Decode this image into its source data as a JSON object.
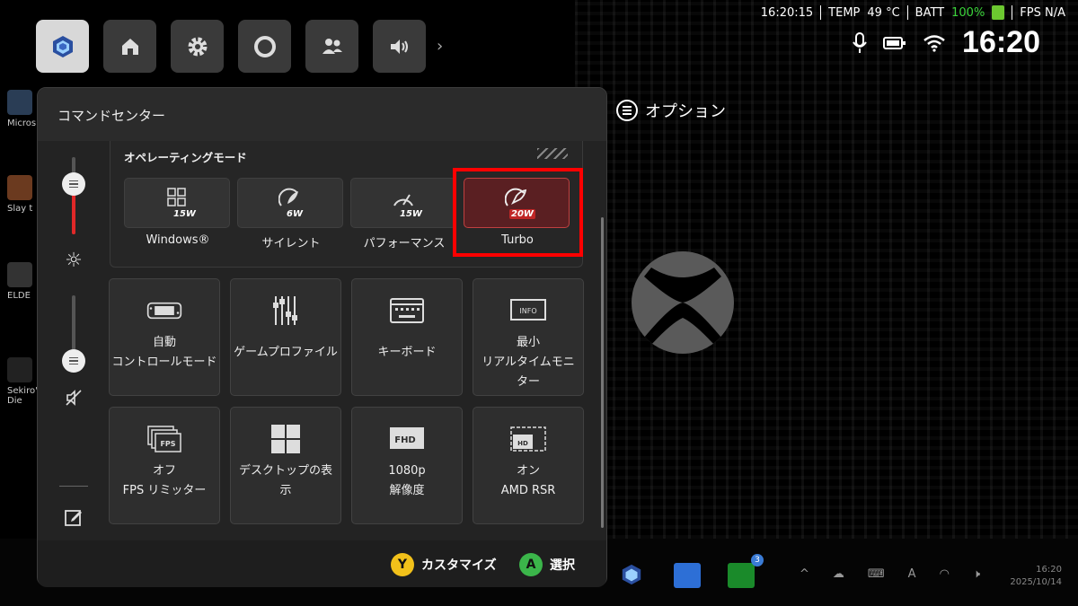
{
  "status": {
    "time_small": "16:20:15",
    "temp_label": "TEMP",
    "temp_value": "49 °C",
    "batt_label": "BATT",
    "batt_value": "100%",
    "fps_label": "FPS N/A",
    "clock": "16:20"
  },
  "options_label": "オプション",
  "desktop_icons": [
    "Micros",
    "Slay t",
    "ELDE",
    "Sekiro\" Die"
  ],
  "panel": {
    "title": "コマンドセンター",
    "operating_mode": {
      "title": "オペレーティングモード",
      "modes": [
        {
          "label": "Windows®",
          "watt": "15W",
          "icon": "windows-grid-icon"
        },
        {
          "label": "サイレント",
          "watt": "6W",
          "icon": "leaf-gauge-icon"
        },
        {
          "label": "パフォーマンス",
          "watt": "15W",
          "icon": "gauge-icon"
        },
        {
          "label": "Turbo",
          "watt": "20W",
          "icon": "rocket-gauge-icon",
          "selected": true
        }
      ]
    },
    "tiles": [
      {
        "line1": "自動",
        "line2": "コントロールモード",
        "icon": "handheld-controller-icon"
      },
      {
        "line1": "ゲームプロファイル",
        "line2": "",
        "icon": "sliders-icon"
      },
      {
        "line1": "キーボード",
        "line2": "",
        "icon": "keyboard-icon"
      },
      {
        "line1": "最小",
        "line2": "リアルタイムモニ",
        "line3": "ター",
        "icon": "info-monitor-icon",
        "icon_text": "INFO"
      },
      {
        "line1": "オフ",
        "line2": "FPS リミッター",
        "icon": "fps-limiter-icon",
        "icon_text": "FPS"
      },
      {
        "line1": "デスクトップの表",
        "line2": "示",
        "icon": "desktop-windows-icon"
      },
      {
        "line1": "1080p",
        "line2": "解像度",
        "icon": "fhd-resolution-icon",
        "icon_text": "FHD"
      },
      {
        "line1": "オン",
        "line2": "AMD RSR",
        "icon": "hd-rsr-icon",
        "icon_text": "HD"
      }
    ],
    "footer": {
      "customize_button": "Y",
      "customize_label": "カスタマイズ",
      "select_button": "A",
      "select_label": "選択"
    }
  },
  "taskbar": {
    "time": "16:20",
    "date": "2025/10/14",
    "xbox_badge": "3",
    "tray_text_icon": "A"
  },
  "colors": {
    "accent_red": "#e02828",
    "highlight_red": "#ff0000",
    "y_button": "#f2c11a",
    "a_button": "#3bb54a",
    "battery_green": "#3ad43a"
  }
}
